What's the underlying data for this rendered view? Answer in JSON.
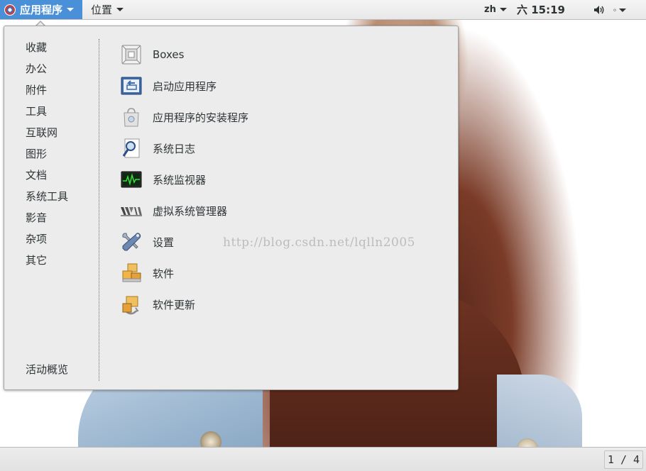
{
  "topbar": {
    "applications_label": "应用程序",
    "places_label": "位置",
    "language": "zh",
    "clock": "六 15:19"
  },
  "menu": {
    "categories": [
      {
        "label": "收藏"
      },
      {
        "label": "办公"
      },
      {
        "label": "附件"
      },
      {
        "label": "工具"
      },
      {
        "label": "互联网"
      },
      {
        "label": "图形"
      },
      {
        "label": "文档"
      },
      {
        "label": "系统工具"
      },
      {
        "label": "影音"
      },
      {
        "label": "杂项"
      },
      {
        "label": "其它"
      }
    ],
    "activities_label": "活动概览",
    "apps": [
      {
        "label": "Boxes",
        "icon": "boxes-icon"
      },
      {
        "label": "启动应用程序",
        "icon": "startup-applications-icon"
      },
      {
        "label": "应用程序的安装程序",
        "icon": "application-installer-icon"
      },
      {
        "label": "系统日志",
        "icon": "system-log-icon"
      },
      {
        "label": "系统监视器",
        "icon": "system-monitor-icon"
      },
      {
        "label": "虚拟系统管理器",
        "icon": "virt-manager-icon"
      },
      {
        "label": "设置",
        "icon": "settings-icon"
      },
      {
        "label": "软件",
        "icon": "software-icon"
      },
      {
        "label": "软件更新",
        "icon": "software-update-icon"
      }
    ]
  },
  "watermark": "http://blog.csdn.net/lqlln2005",
  "bottombar": {
    "workspace_indicator": "1 / 4"
  }
}
